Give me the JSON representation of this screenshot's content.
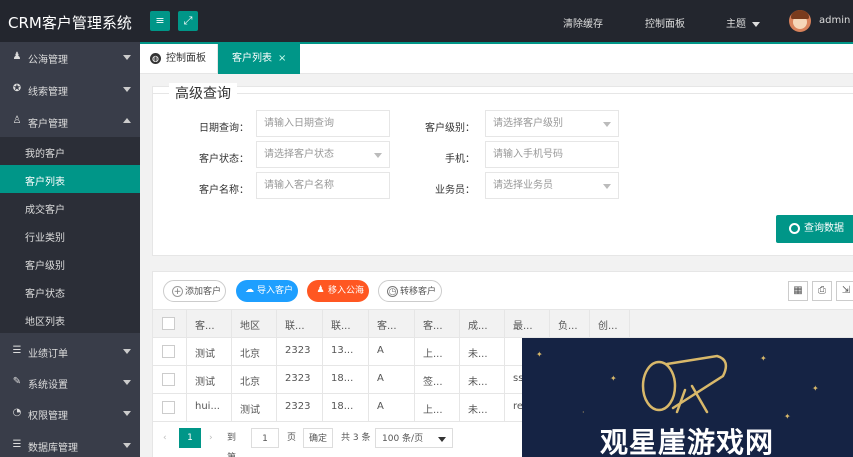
{
  "topbar": {
    "brand": "CRM客户管理系统",
    "menu_btn": "≡",
    "fullscreen_btn": "⤢",
    "clear_cache": "清除缓存",
    "dashboard": "控制面板",
    "theme": "主题",
    "user": "admin"
  },
  "sidebar": {
    "items": [
      {
        "label": "公海管理",
        "icon": "user-group-icon"
      },
      {
        "label": "线索管理",
        "icon": "compass-icon"
      },
      {
        "label": "客户管理",
        "icon": "user-icon"
      }
    ],
    "subitems": [
      "我的客户",
      "客户列表",
      "成交客户",
      "行业类别",
      "客户级别",
      "客户状态",
      "地区列表"
    ],
    "items_after": [
      {
        "label": "业绩订单",
        "icon": "database-icon"
      },
      {
        "label": "系统设置",
        "icon": "wrench-icon"
      },
      {
        "label": "权限管理",
        "icon": "gauge-icon"
      },
      {
        "label": "数据库管理",
        "icon": "database-icon"
      }
    ]
  },
  "tabs": {
    "home": "控制面板",
    "current": "客户列表",
    "close": "×"
  },
  "query": {
    "legend": "高级查询",
    "fields": {
      "date_label": "日期查询：",
      "date_placeholder": "请输入日期查询",
      "level_label": "客户级别：",
      "level_placeholder": "请选择客户级别",
      "status_label": "客户状态：",
      "status_placeholder": "请选择客户状态",
      "phone_label": "手机：",
      "phone_placeholder": "请输入手机号码",
      "name_label": "客户名称：",
      "name_placeholder": "请输入客户名称",
      "sales_label": "业务员：",
      "sales_placeholder": "请选择业务员"
    },
    "search_button": "查询数据"
  },
  "toolbar": {
    "add": "添加客户",
    "import": "导入客户",
    "to_public": "移入公海",
    "transfer": "转移客户"
  },
  "table": {
    "headers": [
      "客...",
      "地区",
      "联...",
      "联...",
      "客...",
      "客...",
      "成...",
      "最...",
      "负...",
      "创..."
    ],
    "rows": [
      [
        "测试",
        "北京",
        "2323",
        "13...",
        "A",
        "上...",
        "未...",
        "",
        "",
        ""
      ],
      [
        "测试",
        "北京",
        "2323",
        "18...",
        "A",
        "签...",
        "未...",
        "ss",
        "",
        ""
      ],
      [
        "hui...",
        "测试",
        "2323",
        "18...",
        "A",
        "上...",
        "未...",
        "re",
        "",
        ""
      ]
    ]
  },
  "pager": {
    "current_page": "1",
    "goto_label": "到第",
    "page_input": "1",
    "page_suffix": "页",
    "confirm": "确定",
    "total": "共 3 条",
    "per_page": "100 条/页"
  },
  "watermark": {
    "text": "观星崖游戏网"
  }
}
